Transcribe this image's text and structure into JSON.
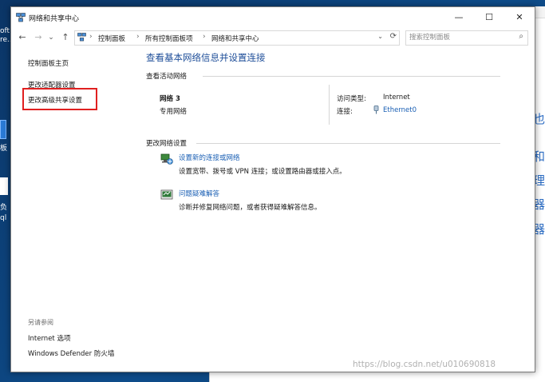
{
  "desktop": {
    "text_lines": [
      "oft",
      "re..."
    ],
    "text2": "板",
    "text3": "负",
    "text4": "ql"
  },
  "background_window": {
    "partial_chars": [
      "也",
      "和",
      "理",
      "器",
      "器"
    ]
  },
  "window": {
    "title": "网络和共享中心",
    "controls": {
      "minimize": "—",
      "maximize": "☐",
      "close": "✕"
    }
  },
  "address_bar": {
    "back": "←",
    "forward": "→",
    "dropdown": "⌄",
    "up": "↑",
    "crumbs": [
      "控制面板",
      "所有控制面板项",
      "网络和共享中心"
    ],
    "separator": "›",
    "refresh": "⟳",
    "search_placeholder": "搜索控制面板",
    "search_icon": "⌕"
  },
  "left_nav": {
    "items": [
      "控制面板主页",
      "更改适配器设置",
      "更改高级共享设置"
    ],
    "see_also_label": "另请参阅",
    "see_also_items": [
      "Internet 选项",
      "Windows Defender 防火墙"
    ]
  },
  "main": {
    "heading": "查看基本网络信息并设置连接",
    "active_networks_label": "查看活动网络",
    "network": {
      "name": "网络 3",
      "type": "专用网络",
      "access_type_label": "访问类型:",
      "access_type_value": "Internet",
      "connection_label": "连接:",
      "connection_value": "Ethernet0"
    },
    "change_settings_label": "更改网络设置",
    "actions": [
      {
        "title": "设置新的连接或网络",
        "desc": "设置宽带、拨号或 VPN 连接；或设置路由器或接入点。"
      },
      {
        "title": "问题疑难解答",
        "desc": "诊断并修复网络问题，或者获得疑难解答信息。"
      }
    ]
  },
  "watermark": "https://blog.csdn.net/u010690818",
  "colors": {
    "link": "#1a5fb4",
    "heading": "#1e4e99",
    "highlight": "#e02020",
    "desktop": "#0c3b6e"
  }
}
